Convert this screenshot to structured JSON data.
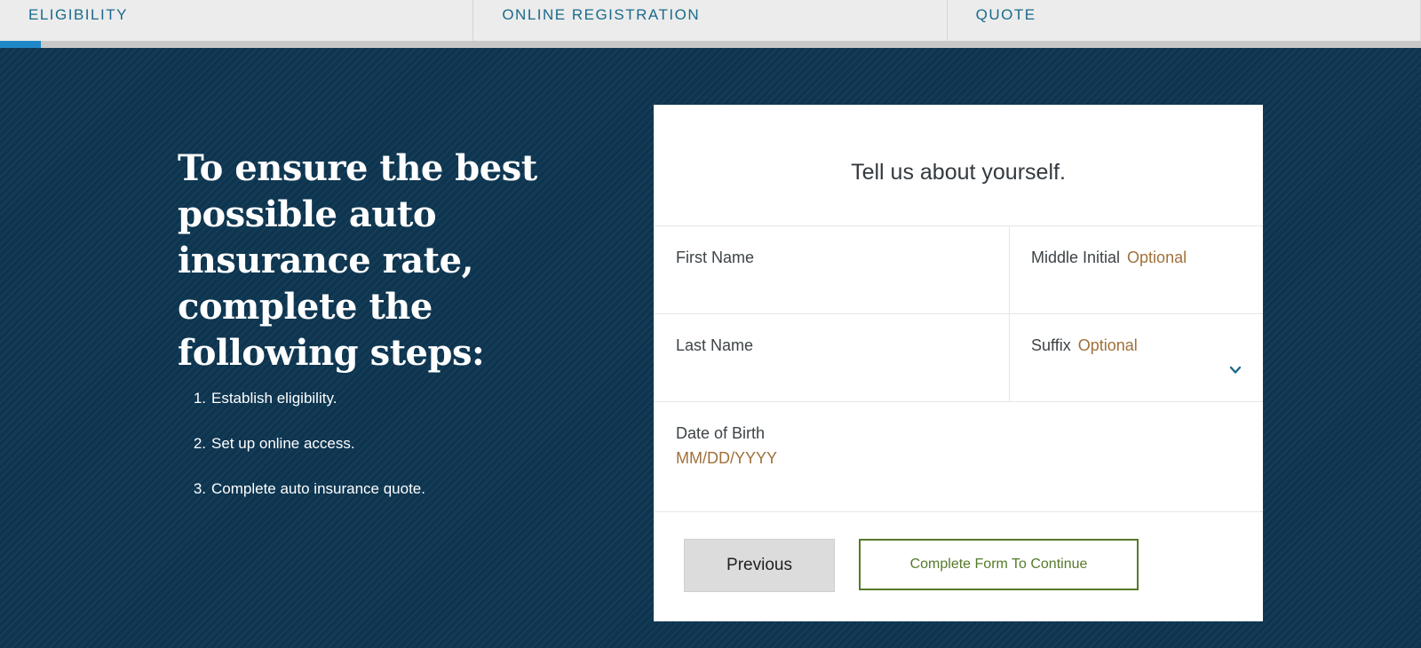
{
  "tabs": [
    {
      "label": "ELIGIBILITY"
    },
    {
      "label": "ONLINE REGISTRATION"
    },
    {
      "label": "QUOTE"
    }
  ],
  "progress": {
    "percent": 2.9
  },
  "hero": {
    "headline": "To ensure the best possible auto insurance rate, complete the following steps:",
    "steps": [
      {
        "num": "1.",
        "text": "Establish eligibility."
      },
      {
        "num": "2.",
        "text": "Set up online access."
      },
      {
        "num": "3.",
        "text": "Complete auto insurance quote."
      }
    ]
  },
  "form": {
    "title": "Tell us about yourself.",
    "first_name": {
      "label": "First Name",
      "value": ""
    },
    "middle_initial": {
      "label": "Middle Initial",
      "optional": "Optional",
      "value": ""
    },
    "last_name": {
      "label": "Last Name",
      "value": ""
    },
    "suffix": {
      "label": "Suffix",
      "optional": "Optional",
      "selected": ""
    },
    "dob": {
      "label": "Date of Birth",
      "placeholder": "MM/DD/YYYY",
      "value": ""
    },
    "previous_label": "Previous",
    "continue_label": "Complete Form To Continue"
  },
  "colors": {
    "tab_text": "#1a6a8a",
    "progress": "#1e88c7",
    "hero_bg": "#0d3550",
    "optional": "#a0703a",
    "continue": "#557a2a"
  }
}
